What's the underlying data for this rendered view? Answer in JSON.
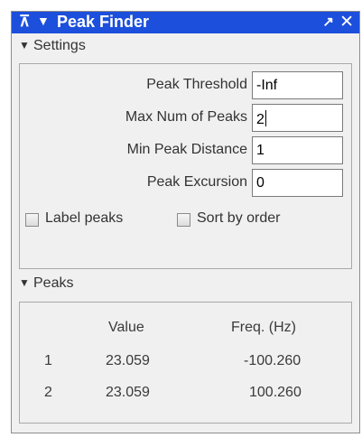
{
  "window": {
    "title": "Peak Finder",
    "pin_glyph": "⊼",
    "menu_glyph": "▼",
    "undock_glyph": "↗",
    "close_glyph": "✕"
  },
  "settings": {
    "header": "Settings",
    "fields": [
      {
        "label": "Peak Threshold",
        "value": "-Inf"
      },
      {
        "label": "Max Num of Peaks",
        "value": "2"
      },
      {
        "label": "Min Peak Distance",
        "value": "1"
      },
      {
        "label": "Peak Excursion",
        "value": "0"
      }
    ],
    "label_peaks": {
      "label": "Label peaks",
      "checked": false
    },
    "sort_by_order": {
      "label": "Sort by order",
      "checked": false
    }
  },
  "peaks": {
    "header": "Peaks",
    "columns": [
      "Value",
      "Freq. (Hz)"
    ],
    "rows": [
      {
        "index": "1",
        "value": "23.059",
        "freq": "-100.260"
      },
      {
        "index": "2",
        "value": "23.059",
        "freq": "100.260"
      }
    ]
  },
  "colors": {
    "titlebar": "#1c4fdc",
    "panel": "#f0f0f0"
  },
  "icons": {
    "collapse": "triangle-down-icon"
  }
}
